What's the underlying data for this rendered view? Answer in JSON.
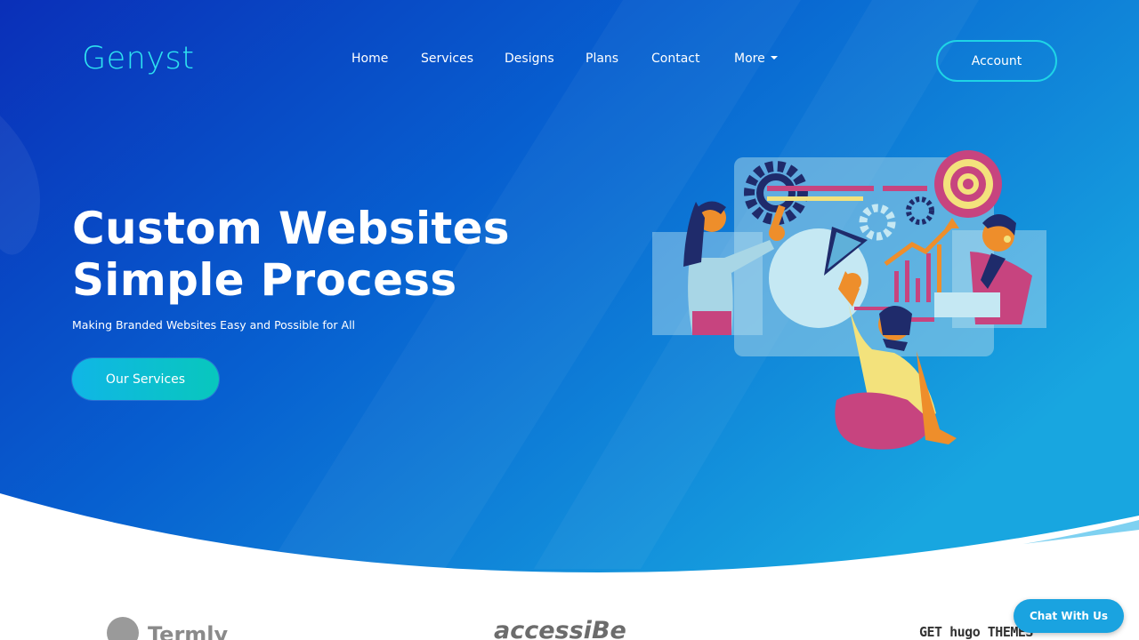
{
  "brand": {
    "logo_text": "Genyst"
  },
  "nav": {
    "items": [
      {
        "label": "Home"
      },
      {
        "label": "Services"
      },
      {
        "label": "Designs"
      },
      {
        "label": "Plans"
      },
      {
        "label": "Contact"
      },
      {
        "label": "More"
      }
    ],
    "account_label": "Account"
  },
  "hero": {
    "title_line1": "Custom Websites",
    "title_line2": "Simple Process",
    "subtitle": "Making Branded Websites Easy and Possible for All",
    "cta_label": "Our Services"
  },
  "partners": {
    "termly": "Termly",
    "accessibe": "accessiBe",
    "gethugo": "GET hugo THEMES"
  },
  "chat": {
    "label": "Chat With Us"
  },
  "colors": {
    "hero_start": "#0a2fb8",
    "hero_end": "#18a6e0",
    "accent_cyan": "#2ee3f0",
    "button_gradient_start": "#10b6e6",
    "button_gradient_end": "#08c7bd",
    "chat_blue": "#1aa3e0"
  }
}
